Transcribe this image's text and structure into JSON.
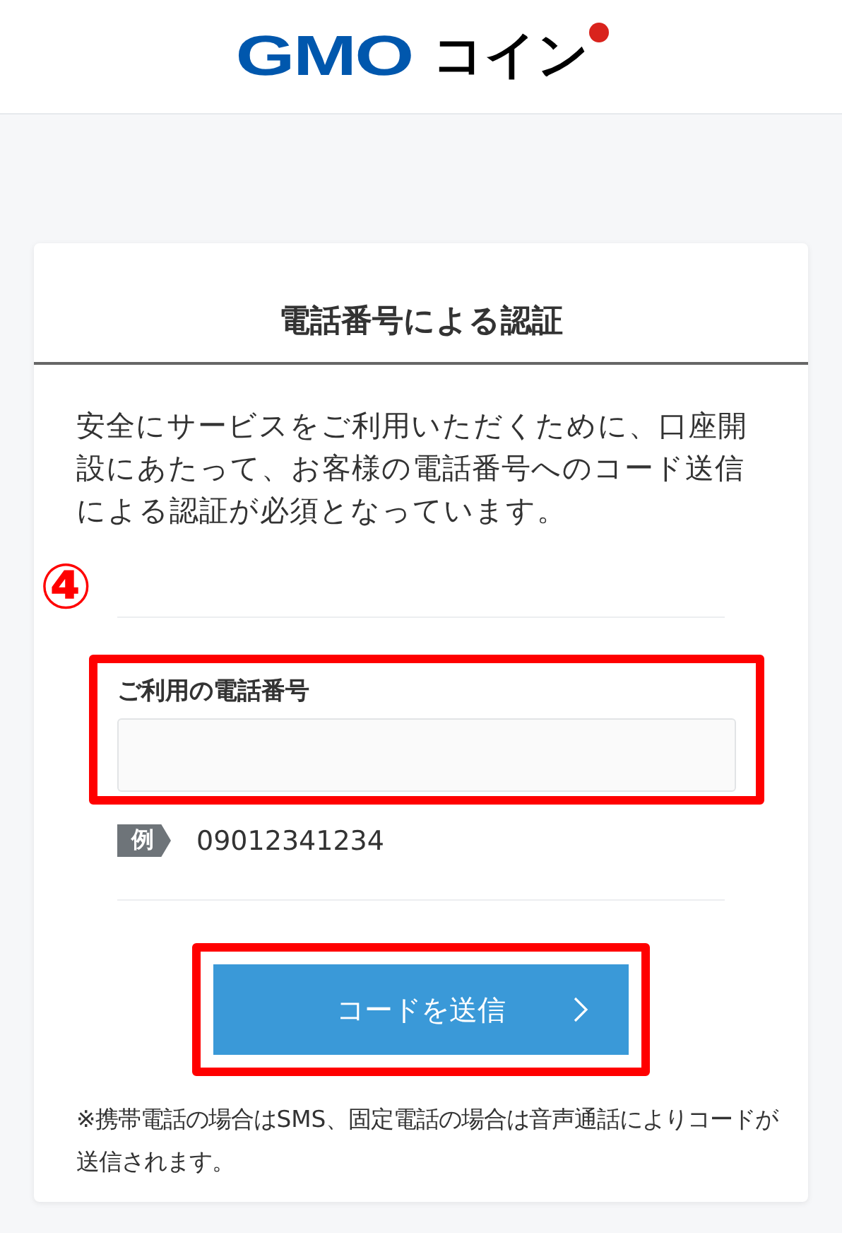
{
  "header": {
    "logo": {
      "latin": "GMO",
      "kana": "コイン"
    }
  },
  "card": {
    "title": "電話番号による認証",
    "intro": "安全にサービスをご利用いただくために、口座開設にあたって、お客様の電話番号へのコード送信による認証が必須となっています。",
    "step_marker": "④",
    "phone_field": {
      "label": "ご利用の電話番号",
      "highlighted": true
    },
    "example": {
      "tag": "例",
      "value": "09012341234"
    },
    "submit_button": {
      "label": "コードを送信",
      "highlighted": true
    },
    "note": "※携帯電話の場合はSMS、固定電話の場合は音声通話によりコードが送信されます。"
  }
}
